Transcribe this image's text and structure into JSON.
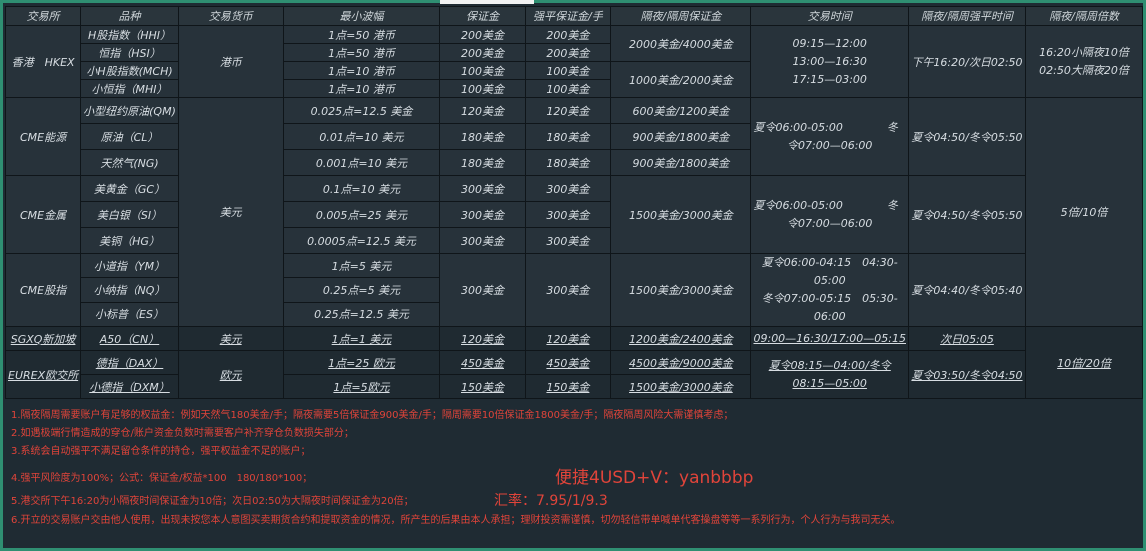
{
  "headers": [
    "交易所",
    "品种",
    "交易货币",
    "最小波幅",
    "保证金",
    "强平保证金/手",
    "隔夜/隔周保证金",
    "交易时间",
    "隔夜/隔周强平时间",
    "隔夜/隔周倍数"
  ],
  "hk": {
    "exchange": "香港　HKEX",
    "currency": "港币",
    "products": [
      "H股指数（HHI）",
      "恒指（HSI）",
      "小H股指数(MCH)",
      "小恒指（MHI）"
    ],
    "ticks": [
      "1点=50 港币",
      "1点=50 港币",
      "1点=10 港币",
      "1点=10 港币"
    ],
    "margins": [
      "200美金",
      "200美金",
      "100美金",
      "100美金"
    ],
    "liq": [
      "200美金",
      "200美金",
      "100美金",
      "100美金"
    ],
    "overnight": [
      "2000美金/4000美金",
      "1000美金/2000美金"
    ],
    "hours": [
      "09:15—12:00",
      "13:00—16:30",
      "17:15—03:00"
    ],
    "liq_time": "下午16:20/次日02:50",
    "multiple": [
      "16:20小隔夜10倍",
      "02:50大隔夜20倍"
    ]
  },
  "cme_energy": {
    "exchange": "CME能源",
    "products": [
      "小型纽约原油(QM)",
      "原油（CL）",
      "天然气(NG)"
    ],
    "ticks": [
      "0.025点=12.5 美金",
      "0.01点=10 美元",
      "0.001点=10 美元"
    ],
    "margins": [
      "120美金",
      "180美金",
      "180美金"
    ],
    "liq": [
      "120美金",
      "180美金",
      "180美金"
    ],
    "overnight": [
      "600美金/1200美金",
      "900美金/1800美金",
      "900美金/1800美金"
    ],
    "hours": [
      "夏令06:00-05:00　　　　冬",
      "令07:00—06:00"
    ],
    "liq_time": "夏令04:50/冬令05:50"
  },
  "cme_currency": "美元",
  "cme_multiple": "5倍/10倍",
  "cme_metal": {
    "exchange": "CME金属",
    "products": [
      "美黄金（GC）",
      "美白银（SI）",
      "美铜（HG）"
    ],
    "ticks": [
      "0.1点=10 美元",
      "0.005点=25 美元",
      "0.0005点=12.5 美元"
    ],
    "margins": [
      "300美金",
      "300美金",
      "300美金"
    ],
    "liq": [
      "300美金",
      "300美金",
      "300美金"
    ],
    "overnight": "1500美金/3000美金",
    "hours": [
      "夏令06:00-05:00　　　　冬",
      "令07:00—06:00"
    ],
    "liq_time": "夏令04:50/冬令05:50"
  },
  "cme_index": {
    "exchange": "CME股指",
    "products": [
      "小道指（YM）",
      "小纳指（NQ）",
      "小标普（ES）"
    ],
    "ticks": [
      "1点=5 美元",
      "0.25点=5 美元",
      "0.25点=12.5 美元"
    ],
    "margin": "300美金",
    "liq": "300美金",
    "overnight": "1500美金/3000美金",
    "hours": [
      "夏令06:00-04:15　04:30-05:00",
      "冬令07:00-05:15　05:30-06:00"
    ],
    "liq_time": "夏令04:40/冬令05:40"
  },
  "sgx": {
    "exchange": "SGXQ新加坡",
    "product": "A50（CN）",
    "currency": "美元",
    "tick": "1点=1 美元",
    "margin": "120美金",
    "liq": "120美金",
    "overnight": "1200美金/2400美金",
    "hours": "09:00—16:30/17:00—05:15",
    "liq_time": "次日05:05"
  },
  "eurex": {
    "exchange": "EUREX欧交所",
    "products": [
      "德指（DAX）",
      "小德指（DXM）"
    ],
    "currency": "欧元",
    "ticks": [
      "1点=25 欧元",
      "1点=5欧元"
    ],
    "margins": [
      "450美金",
      "150美金"
    ],
    "liq": [
      "450美金",
      "150美金"
    ],
    "overnight": [
      "4500美金/9000美金",
      "1500美金/3000美金"
    ],
    "hours": [
      "夏令08:15—04:00/冬令",
      "08:15—05:00"
    ],
    "liq_time": "夏令03:50/冬令04:50"
  },
  "se_multiple": "10倍/20倍",
  "notes": [
    "1.隔夜隔周需要账户有足够的权益金：例如天然气180美金/手；隔夜需要5倍保证金900美金/手；隔周需要10倍保证金1800美金/手；隔夜隔周风险大需谨慎考虑；",
    "2.如遇极端行情造成的穿仓/账户资金负数时需要客户补齐穿仓负数损失部分；",
    "3.系统会自动强平不满足留仓条件的持仓，强平权益金不足的账户；",
    "4.强平风险度为100%；公式：保证金/权益*100　180/180*100；",
    "5.港交所下午16:20为小隔夜时间保证金为10倍；次日02:50为大隔夜时间保证金为20倍；",
    "6.开立的交易账户交由他人使用，出现未按您本人意图买卖期货合约和提取资金的情况，所产生的后果由本人承担；理财投资需谨慎，切勿轻信带单喊单代客操盘等等一系列行为，个人行为与我司无关。"
  ],
  "contact": "便捷4USD+V：yanbbbp",
  "rate": "汇率：7.95/1/9.3"
}
